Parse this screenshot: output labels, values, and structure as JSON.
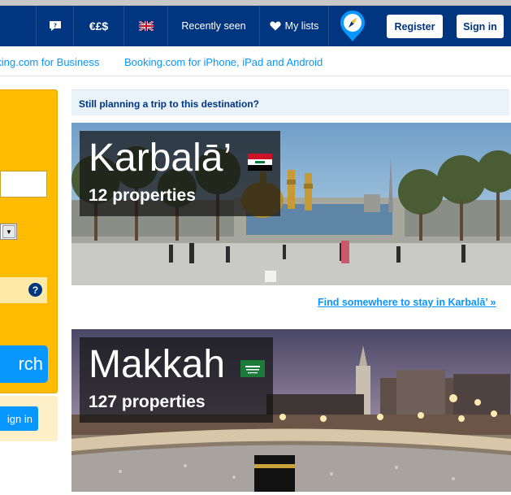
{
  "navbar": {
    "currency_label": "€£$",
    "recently_seen_label": "Recently seen",
    "my_lists_label": "My lists",
    "register_label": "Register",
    "signin_label": "Sign in"
  },
  "subnav": {
    "business_link": "oking.com for Business",
    "mobile_link": "Booking.com for iPhone, iPad and Android"
  },
  "sidebar": {
    "search_label": "rch",
    "help_icon": "?",
    "signin_label": "ign in"
  },
  "planning_banner": "Still planning a trip to this destination?",
  "destinations": [
    {
      "name": "Karbalā’",
      "properties": "12 properties",
      "flag": "iraq-flag"
    },
    {
      "name": "Makkah",
      "properties": "127 properties",
      "flag": "saudi-flag"
    }
  ],
  "find_link": "Find somewhere to stay in Karbalā’ »",
  "colors": {
    "brand_blue": "#003580",
    "link_blue": "#0896ff",
    "search_yellow": "#febb02"
  }
}
